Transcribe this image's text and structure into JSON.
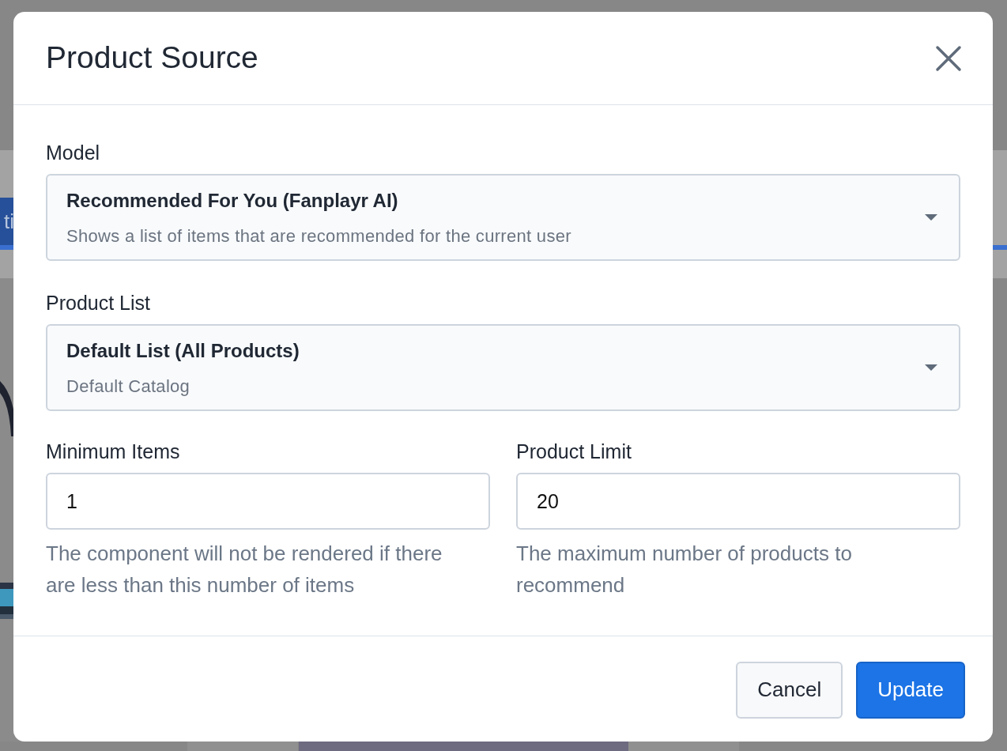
{
  "background": {
    "tab_fragment": "ti"
  },
  "dialog": {
    "title": "Product Source",
    "selects": [
      {
        "label": "Model",
        "value": "Recommended For You (Fanplayr AI)",
        "description": "Shows a list of items that are recommended for the current user"
      },
      {
        "label": "Product List",
        "value": "Default List (All Products)",
        "description": "Default Catalog"
      }
    ],
    "inputs": [
      {
        "label": "Minimum Items",
        "value": "1",
        "help": "The component will not be rendered if there are less than this number of items"
      },
      {
        "label": "Product Limit",
        "value": "20",
        "help": "The maximum number of products to recommend"
      }
    ],
    "buttons": [
      {
        "label": "Cancel",
        "kind": "secondary"
      },
      {
        "label": "Update",
        "kind": "primary"
      }
    ]
  }
}
